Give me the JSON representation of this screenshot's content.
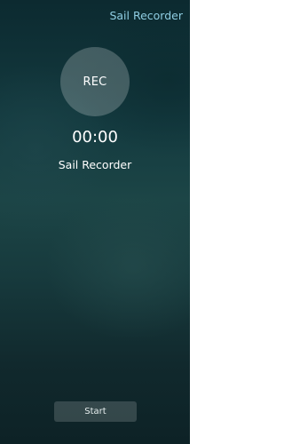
{
  "header": {
    "title": "Sail Recorder"
  },
  "recorder": {
    "rec_label": "REC",
    "timer": "00:00",
    "app_name": "Sail Recorder"
  },
  "controls": {
    "start_label": "Start"
  },
  "colors": {
    "header_accent": "#8fcde2",
    "background_dark": "#0c2a30",
    "background_mid": "#1c4546",
    "text_primary": "#ffffff"
  }
}
